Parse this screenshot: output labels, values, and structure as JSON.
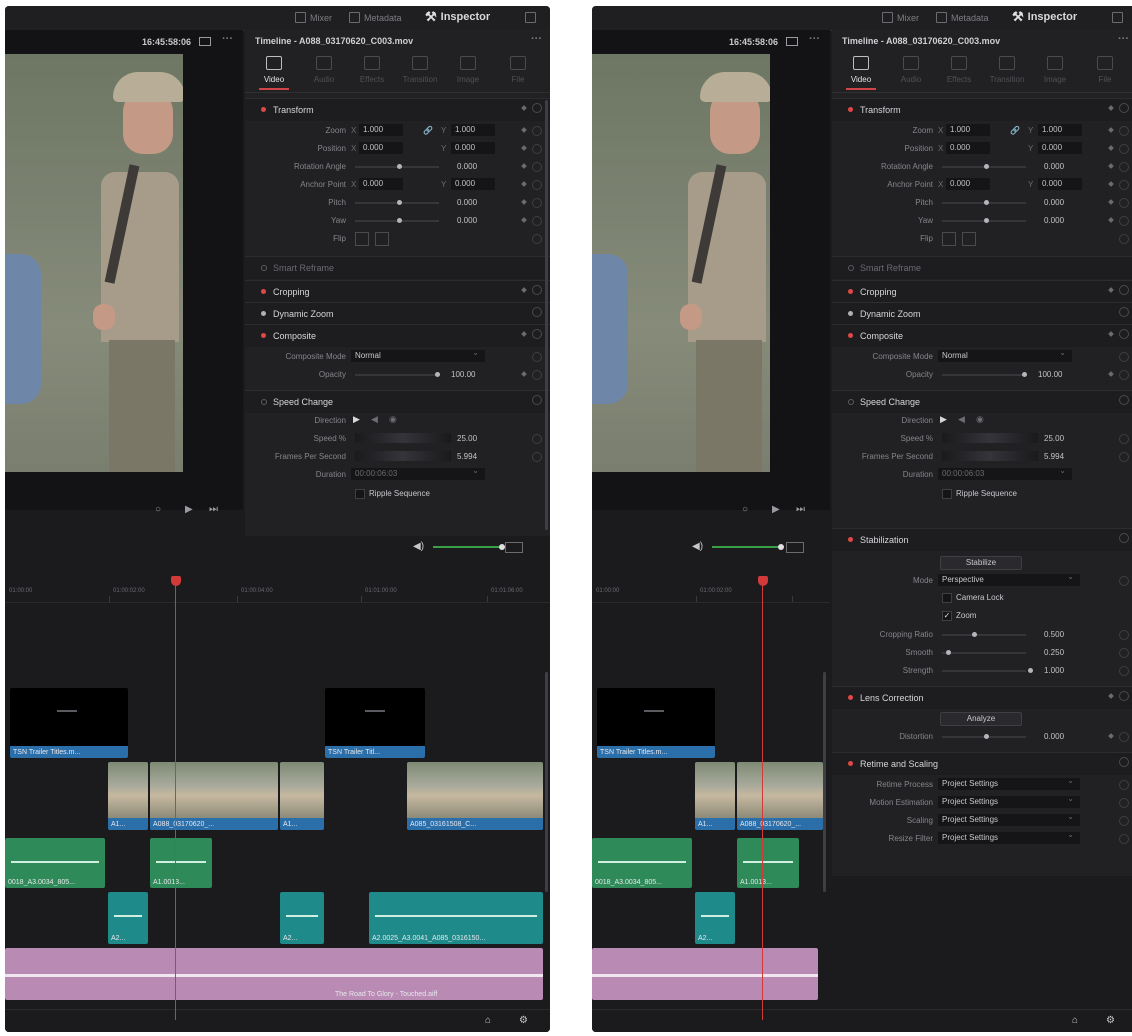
{
  "topnav": {
    "mixer": "Mixer",
    "metadata": "Metadata",
    "inspector": "Inspector"
  },
  "viewer": {
    "timecode": "16:45:58:06"
  },
  "inspector": {
    "title": "Timeline - A088_03170620_C003.mov",
    "tabs": [
      "Video",
      "Audio",
      "Effects",
      "Transition",
      "Image",
      "File"
    ],
    "transform": {
      "title": "Transform",
      "zoom_label": "Zoom",
      "zoom_x": "1.000",
      "zoom_y": "1.000",
      "position_label": "Position",
      "position_x": "0.000",
      "position_y": "0.000",
      "rotation_label": "Rotation Angle",
      "rotation_value": "0.000",
      "anchor_label": "Anchor Point",
      "anchor_x": "0.000",
      "anchor_y": "0.000",
      "pitch_label": "Pitch",
      "pitch_value": "0.000",
      "yaw_label": "Yaw",
      "yaw_value": "0.000",
      "flip_label": "Flip",
      "axis_x": "X",
      "axis_y": "Y"
    },
    "smart_reframe": "Smart Reframe",
    "cropping": "Cropping",
    "dynamic_zoom": "Dynamic Zoom",
    "composite": {
      "title": "Composite",
      "mode_label": "Composite Mode",
      "mode_value": "Normal",
      "opacity_label": "Opacity",
      "opacity_value": "100.00"
    },
    "speed_change": {
      "title": "Speed Change",
      "direction_label": "Direction",
      "speed_label": "Speed %",
      "speed_value": "25.00",
      "fps_label": "Frames Per Second",
      "fps_value": "5.994",
      "duration_label": "Duration",
      "duration_value": "00:00:06:03",
      "ripple_label": "Ripple Sequence"
    },
    "stabilization": {
      "title": "Stabilization",
      "stabilize_button": "Stabilize",
      "mode_label": "Mode",
      "mode_value": "Perspective",
      "camera_lock": "Camera Lock",
      "zoom": "Zoom",
      "cropping_ratio_label": "Cropping Ratio",
      "cropping_ratio_value": "0.500",
      "smooth_label": "Smooth",
      "smooth_value": "0.250",
      "strength_label": "Strength",
      "strength_value": "1.000"
    },
    "lens_correction": {
      "title": "Lens Correction",
      "analyze_button": "Analyze",
      "distortion_label": "Distortion",
      "distortion_value": "0.000"
    },
    "retime_scaling": {
      "title": "Retime and Scaling",
      "retime_process_label": "Retime Process",
      "retime_process_value": "Project Settings",
      "motion_estimation_label": "Motion Estimation",
      "motion_estimation_value": "Project Settings",
      "scaling_label": "Scaling",
      "scaling_value": "Project Settings",
      "resize_filter_label": "Resize Filter",
      "resize_filter_value": "Project Settings"
    }
  },
  "timeline": {
    "clips": {
      "title1": "TSN Trailer Titles.m...",
      "title2": "TSN Trailer Titl...",
      "video_a1": "A1...",
      "video_main": "A088_03170620_...",
      "video_a1b": "A1...",
      "video_right": "A085_03161508_C...",
      "audio_g1": "0018_A3.0034_805...",
      "audio_g2": "A1.0013...",
      "audio_t1": "A2...",
      "audio_t2": "A2...",
      "audio_t3": "A2.0025_A3.0041_A085_0316150...",
      "music": "The Road To Glory - Touched.aiff"
    }
  },
  "colors": {
    "accent_red": "#d23a3a",
    "video_clip_blue": "#2a6eaa",
    "audio_green": "#2e8a58",
    "audio_teal": "#1f8a8a",
    "music_purple": "#b88ab4"
  }
}
